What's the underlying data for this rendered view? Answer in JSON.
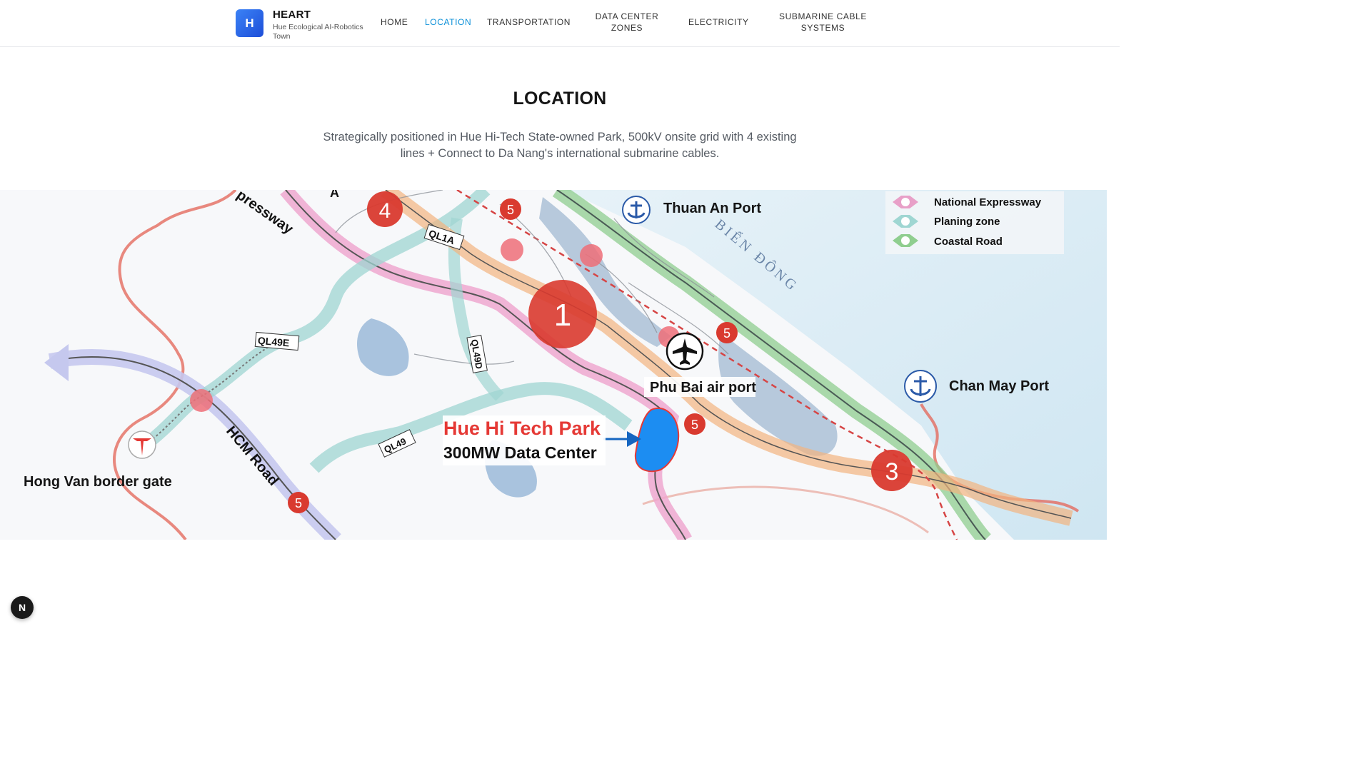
{
  "brand": {
    "logo_letter": "H",
    "title": "HEART",
    "subtitle": "Hue Ecological AI-Robotics Town",
    "accent": "#2563eb"
  },
  "nav": {
    "items": [
      {
        "label": "HOME",
        "active": false
      },
      {
        "label": "LOCATION",
        "active": true
      },
      {
        "label": "TRANSPORTATION",
        "active": false
      },
      {
        "label": "DATA CENTER ZONES",
        "active": false
      },
      {
        "label": "ELECTRICITY",
        "active": false
      },
      {
        "label": "SUBMARINE CABLE SYSTEMS",
        "active": false
      }
    ],
    "active_color": "#0a8fd8"
  },
  "section": {
    "title": "LOCATION",
    "description": "Strategically positioned in Hue Hi-Tech State-owned Park, 500kV onsite grid with 4 existing lines + Connect to Da Nang's international submarine cables."
  },
  "map": {
    "legend": [
      {
        "label": "National Expressway",
        "color": "#e8a0c8"
      },
      {
        "label": "Planing zone",
        "color": "#9fd6d2"
      },
      {
        "label": "Coastal Road",
        "color": "#8fce8f"
      }
    ],
    "places": {
      "thuan_an_port": "Thuan An Port",
      "chan_may_port": "Chan May Port",
      "phu_bai_airport": "Phu Bai air port",
      "hong_van": "Hong Van border gate",
      "sea_name": "BIỂN ĐÔNG"
    },
    "roads": {
      "expressway": "pressway",
      "ql1a": "QL1A",
      "ql49e": "QL49E",
      "ql49d": "QL49D",
      "ql49": "QL49",
      "hcm_road": "HCM Road",
      "cut_a": "A"
    },
    "zones": {
      "z1": "1",
      "z3": "3",
      "z4": "4",
      "z5": "5"
    },
    "park": {
      "name": "Hue Hi Tech Park",
      "capacity": "300MW Data Center"
    }
  },
  "dev_badge": "N"
}
